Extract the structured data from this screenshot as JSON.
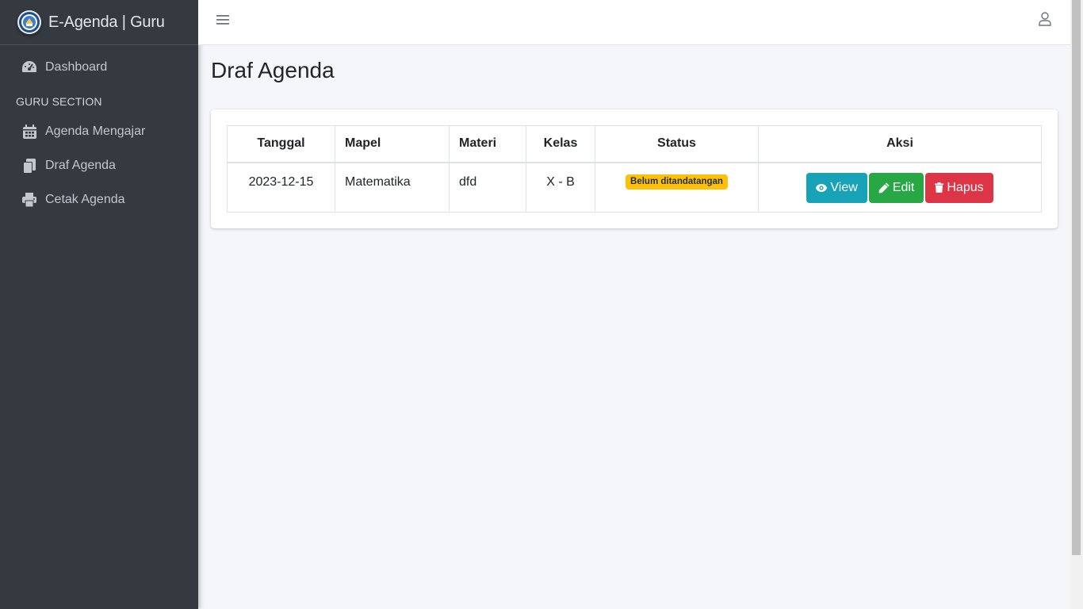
{
  "brand": {
    "title": "E-Agenda | Guru"
  },
  "sidebar": {
    "dashboard": "Dashboard",
    "section_header": "GURU SECTION",
    "items": [
      {
        "label": "Agenda Mengajar",
        "icon": "calendar-icon"
      },
      {
        "label": "Draf Agenda",
        "icon": "copy-icon"
      },
      {
        "label": "Cetak Agenda",
        "icon": "printer-icon"
      }
    ]
  },
  "page": {
    "title": "Draf Agenda"
  },
  "table": {
    "headers": {
      "tanggal": "Tanggal",
      "mapel": "Mapel",
      "materi": "Materi",
      "kelas": "Kelas",
      "status": "Status",
      "aksi": "Aksi"
    },
    "rows": [
      {
        "tanggal": "2023-12-15",
        "mapel": "Matematika",
        "materi": "dfd",
        "kelas": "X - B",
        "status": "Belum ditandatangan"
      }
    ]
  },
  "actions": {
    "view": "View",
    "edit": "Edit",
    "hapus": "Hapus"
  },
  "colors": {
    "sidebar": "#343a40",
    "info": "#17a2b8",
    "success": "#28a745",
    "danger": "#dc3545",
    "warning": "#ffc107"
  }
}
